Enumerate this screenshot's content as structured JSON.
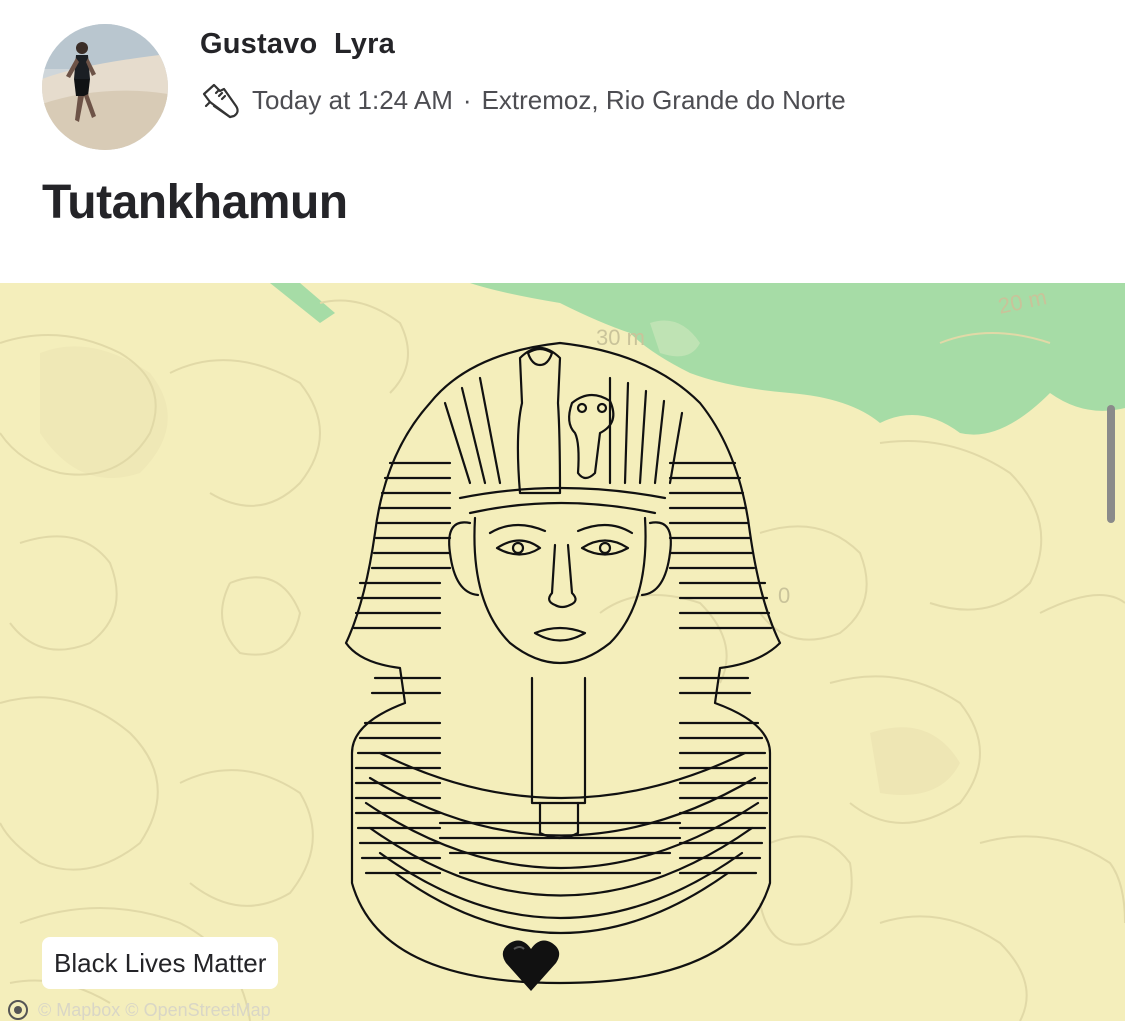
{
  "athlete": {
    "name": "Gustavo  Lyra"
  },
  "activity": {
    "time": "Today at 1:24 AM",
    "separator": "·",
    "location": "Extremoz, Rio Grande do Norte",
    "title": "Tutankhamun",
    "type_icon": "running-shoe-icon"
  },
  "map": {
    "contour_labels": [
      "30 m",
      "20 m",
      "0"
    ],
    "caption": "Black Lives Matter",
    "attribution": "© Mapbox © OpenStreetMap",
    "colors": {
      "land": "#f4eebb",
      "water": "#a6dca6",
      "route": "#111111"
    }
  }
}
